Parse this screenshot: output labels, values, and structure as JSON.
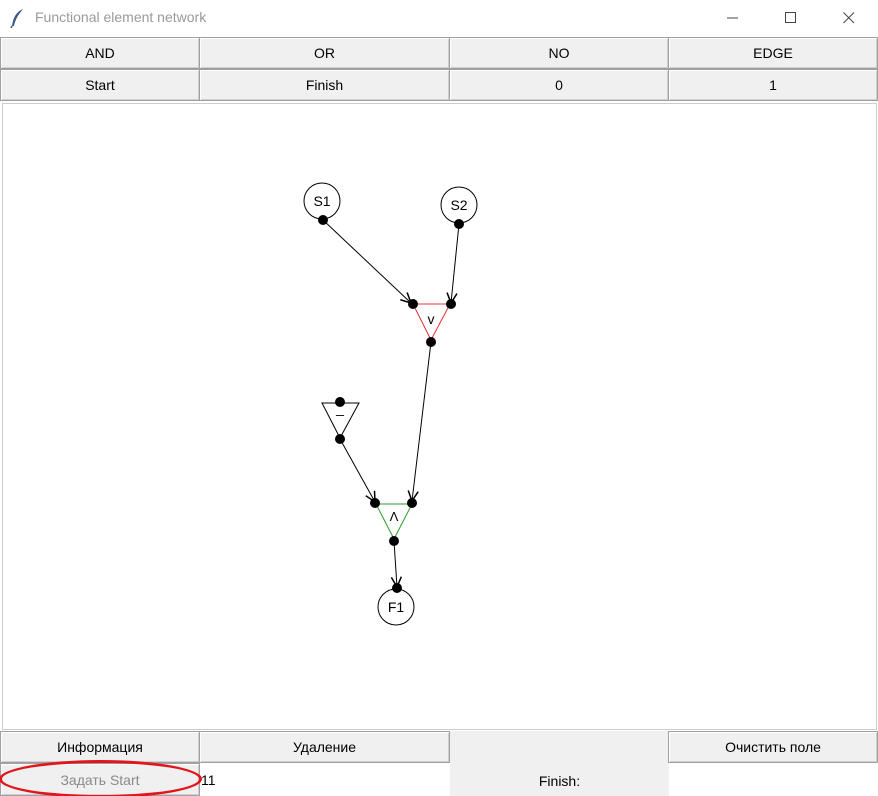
{
  "window": {
    "title": "Functional element network"
  },
  "toolbar": {
    "row1": {
      "and": "AND",
      "or": "OR",
      "no": "NO",
      "edge": "EDGE"
    },
    "row2": {
      "start": "Start",
      "finish": "Finish",
      "value0": "0",
      "value1": "1"
    }
  },
  "graph": {
    "nodes": {
      "s1": "S1",
      "s2": "S2",
      "f1": "F1"
    },
    "gates": {
      "or_symbol": "v",
      "and_symbol": "Λ",
      "not_symbol": "_"
    },
    "colors": {
      "or_gate": "#e83030",
      "and_gate": "#2a9a2a",
      "not_gate": "#000000",
      "edge": "#000000"
    }
  },
  "bottom": {
    "info_button": "Информация",
    "delete_button": "Удаление",
    "clear_button": "Очистить поле",
    "set_start_button": "Задать Start",
    "start_entry_value": "11",
    "finish_label": "Finish:"
  },
  "annotation": {
    "highlight_color": "#e2141c"
  }
}
